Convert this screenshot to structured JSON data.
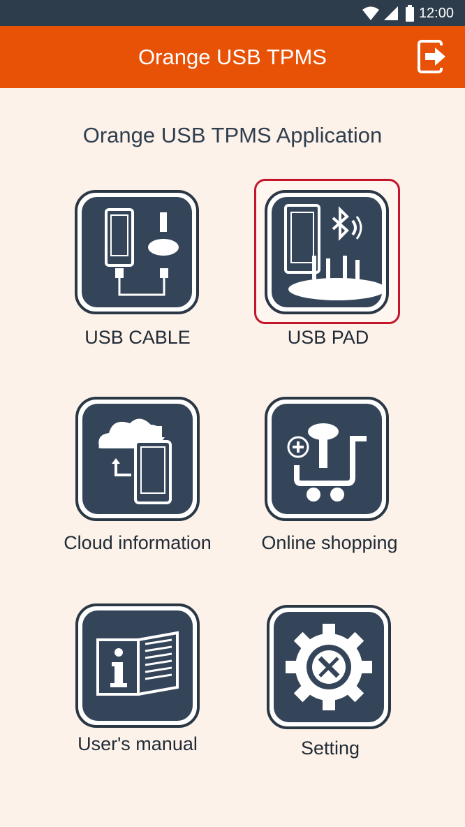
{
  "status_bar": {
    "time": "12:00",
    "icons": [
      "wifi-icon",
      "cellular-signal-icon",
      "battery-icon"
    ]
  },
  "app_bar": {
    "title": "Orange USB TPMS",
    "exit_icon": "exit-icon"
  },
  "main": {
    "heading": "Orange USB TPMS Application",
    "tiles": [
      {
        "label": "USB CABLE",
        "icon": "usb-cable-icon",
        "selected": false
      },
      {
        "label": "USB PAD",
        "icon": "usb-pad-icon",
        "selected": true
      },
      {
        "label": "Cloud information",
        "icon": "cloud-sync-icon",
        "selected": false
      },
      {
        "label": "Online shopping",
        "icon": "shopping-cart-icon",
        "selected": false
      },
      {
        "label": "User's manual",
        "icon": "manual-icon",
        "selected": false
      },
      {
        "label": "Setting",
        "icon": "settings-gear-icon",
        "selected": false
      }
    ]
  },
  "colors": {
    "app_bar": "#e85207",
    "status_bar": "#2e3d4c",
    "background": "#fdf2ea",
    "icon_fill": "#34455a",
    "selected_border": "#c5152b"
  }
}
